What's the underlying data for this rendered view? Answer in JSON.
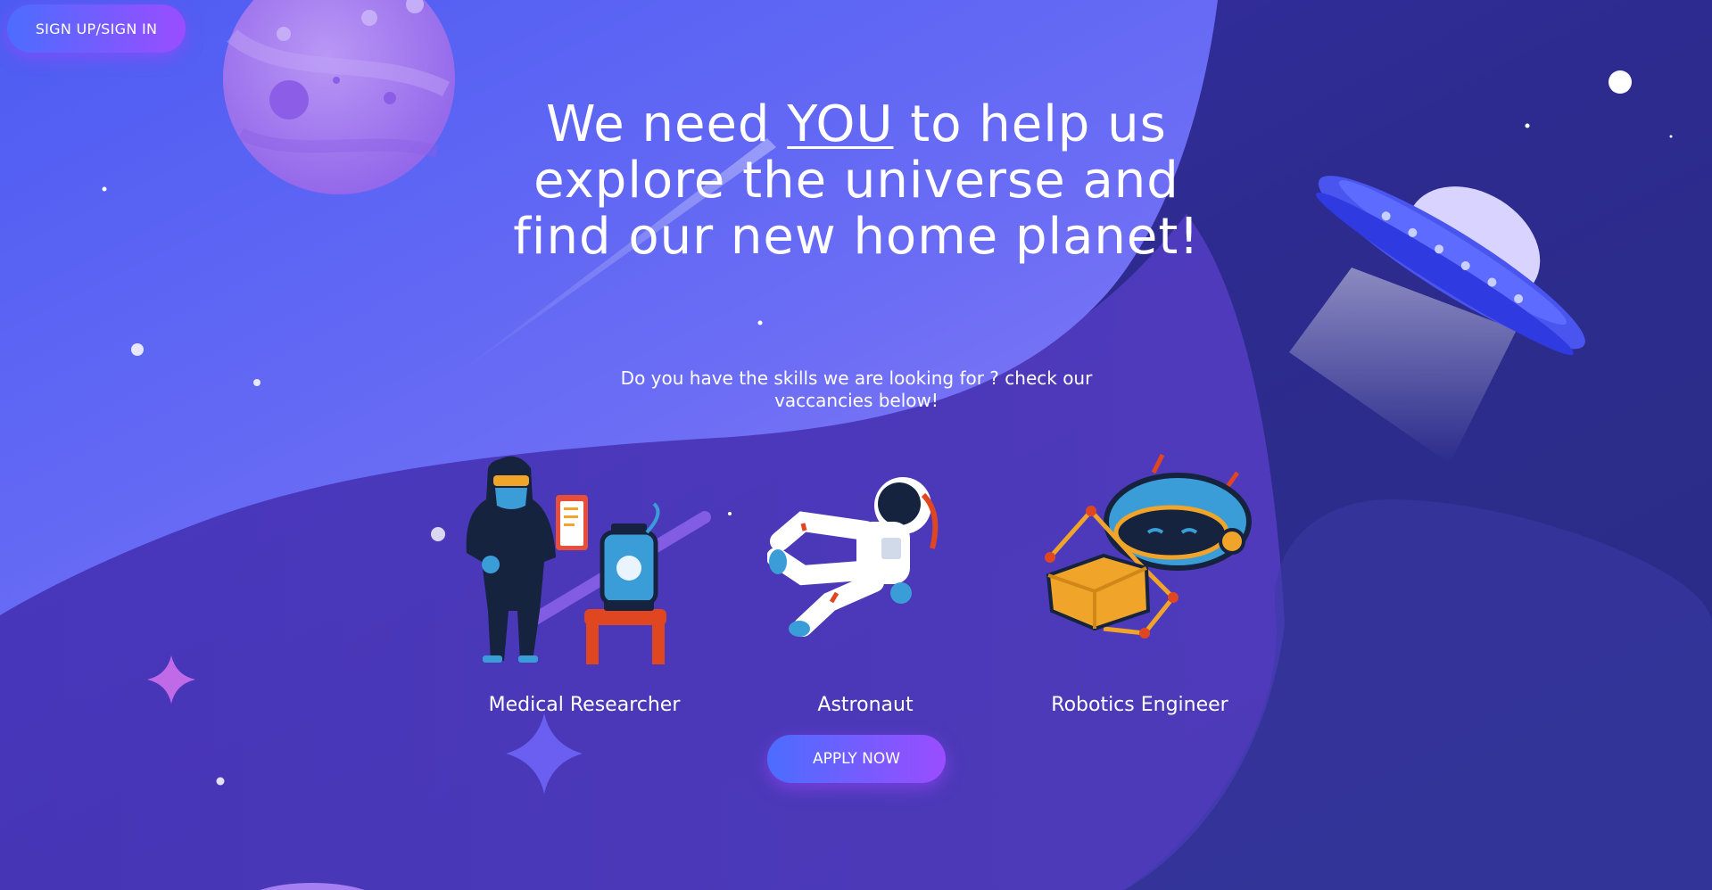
{
  "header": {
    "signin_label": "SIGN UP/SIGN IN"
  },
  "hero": {
    "title_before": "We need ",
    "title_emphasis": "YOU",
    "title_after": " to help us explore the universe and find our new home planet!",
    "subtitle": "Do you have the skills we are looking for ? check our vaccancies below!"
  },
  "jobs": [
    {
      "label": "Medical Researcher"
    },
    {
      "label": "Astronaut"
    },
    {
      "label": "Robotics Engineer"
    }
  ],
  "cta": {
    "apply_label": "APPLY NOW"
  },
  "colors": {
    "bg_dark": "#2b2d8a",
    "bg_light": "#6f6ff5",
    "button_gradient_start": "#4c6dff",
    "button_gradient_end": "#9a4dff",
    "planet": "#a57ef2",
    "ufo": "#4a55f0"
  }
}
